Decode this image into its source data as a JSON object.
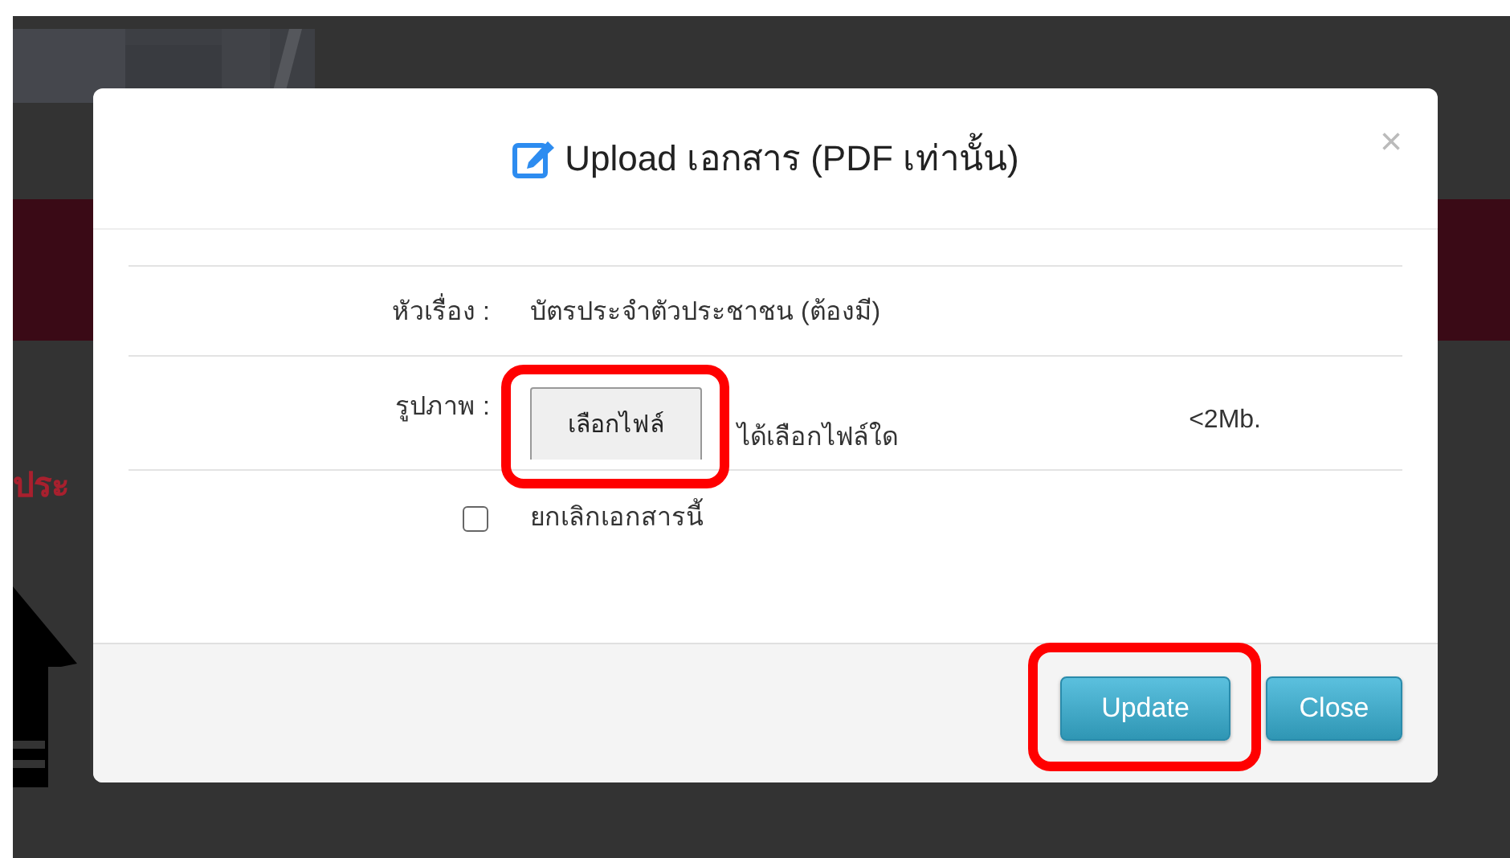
{
  "background": {
    "side_text": "ประ"
  },
  "dialog": {
    "title": "Upload เอกสาร (PDF เท่านั้น)",
    "close_symbol": "×",
    "fields": [
      {
        "kind": "text",
        "label": "หัวเรื่อง :",
        "value": "บัตรประจำตัวประชาชน (ต้องมี)"
      },
      {
        "kind": "file",
        "label": "รูปภาพ :",
        "button": "เลือกไฟล์",
        "status": "ได้เลือกไฟล์ใด",
        "hint": "<2Mb.",
        "highlighted": true
      },
      {
        "kind": "checkbox",
        "label": "ยกเลิกเอกสารนี้",
        "checked": false
      }
    ],
    "buttons": [
      {
        "label": "Update",
        "highlighted": true
      },
      {
        "label": "Close",
        "highlighted": false
      }
    ]
  }
}
